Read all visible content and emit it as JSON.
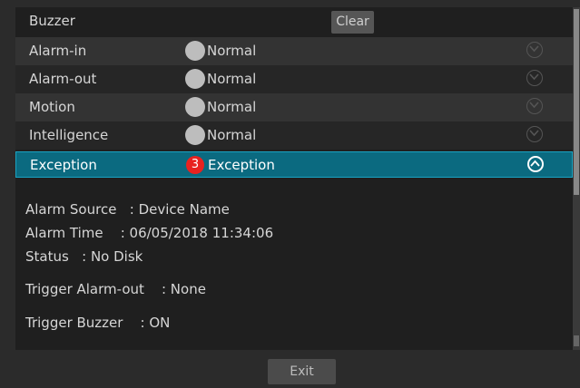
{
  "header": {
    "title": "Buzzer",
    "clear_label": "Clear"
  },
  "rows": [
    {
      "label": "Alarm-in",
      "status": "Normal"
    },
    {
      "label": "Alarm-out",
      "status": "Normal"
    },
    {
      "label": "Motion",
      "status": "Normal"
    },
    {
      "label": "Intelligence",
      "status": "Normal"
    }
  ],
  "selected": {
    "label": "Exception",
    "badge": "3",
    "status": "Exception"
  },
  "details": {
    "source_key": "Alarm Source",
    "source_val": ": Device Name",
    "time_key": "Alarm Time",
    "time_val": ": 06/05/2018 11:34:06",
    "status_key": "Status",
    "status_val": ": No Disk",
    "trigger_out_key": "Trigger Alarm-out",
    "trigger_out_val": ": None",
    "trigger_buzzer_key": "Trigger Buzzer",
    "trigger_buzzer_val": ": ON"
  },
  "footer": {
    "exit_label": "Exit"
  },
  "colors": {
    "selected_bg": "#0b6a80",
    "badge": "#e8221f"
  },
  "icons": {
    "normal": "status-circle-icon",
    "expand": "chevron-down-icon",
    "collapse": "chevron-up-icon"
  }
}
